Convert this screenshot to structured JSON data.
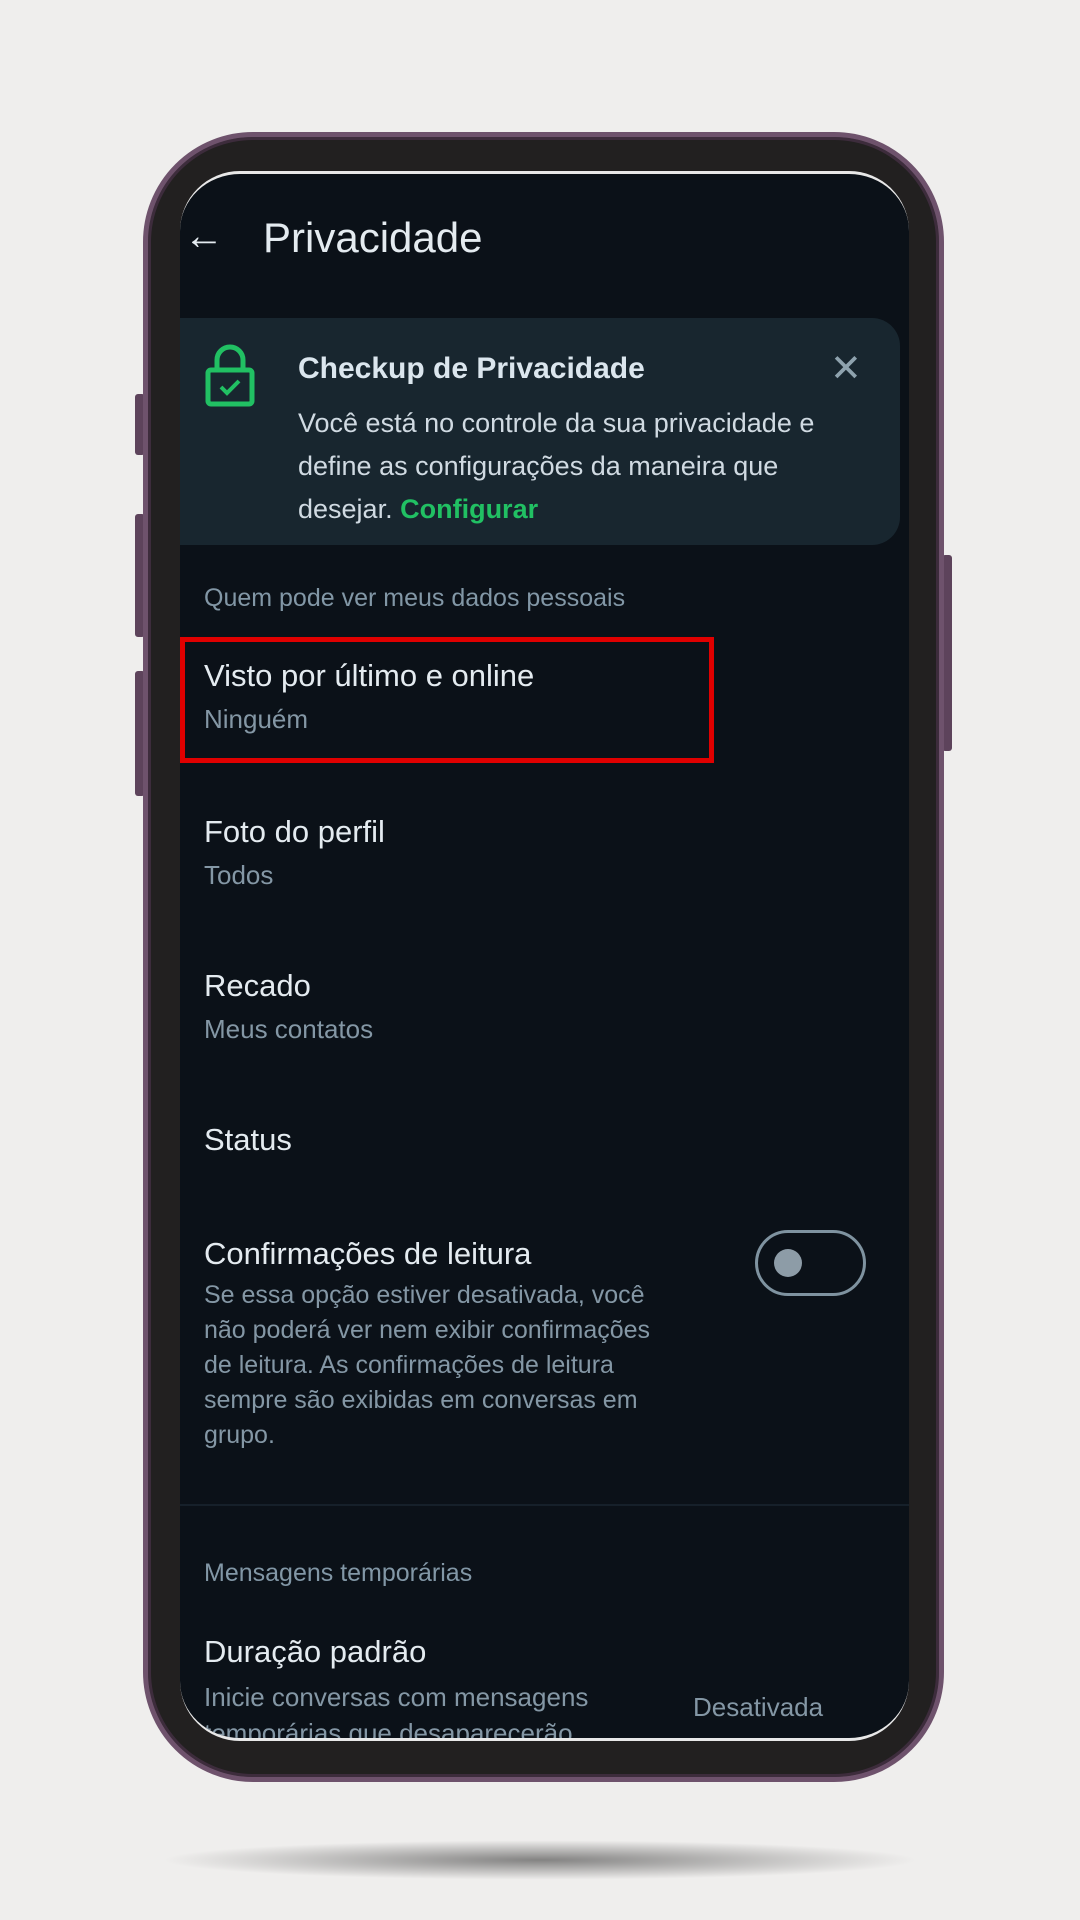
{
  "header": {
    "title": "Privacidade",
    "back_icon": "arrow-left-icon"
  },
  "checkup_card": {
    "title": "Checkup de Privacidade",
    "body": "Você está no controle da sua privacidade e define as configurações da maneira que desejar.",
    "link": "Configurar",
    "icon": "lock-check-icon",
    "close_icon": "close-icon",
    "link_color": "#21c063"
  },
  "section_personal": "Quem pode ver meus dados pessoais",
  "items": [
    {
      "title": "Visto por último e online",
      "value": "Ninguém",
      "highlighted": true
    },
    {
      "title": "Foto do perfil",
      "value": "Todos"
    },
    {
      "title": "Recado",
      "value": "Meus contatos"
    },
    {
      "title": "Status"
    }
  ],
  "read_receipts": {
    "title": "Confirmações de leitura",
    "description": "Se essa opção estiver desativada, você não poderá ver nem exibir confirmações de leitura. As confirmações de leitura sempre são exibidas em conversas em grupo.",
    "enabled": false
  },
  "section_temp": "Mensagens temporárias",
  "default_duration": {
    "title": "Duração padrão",
    "description": "Inicie conversas com mensagens temporárias que desaparecerão",
    "value": "Desativada"
  },
  "highlight_color": "#e00000"
}
